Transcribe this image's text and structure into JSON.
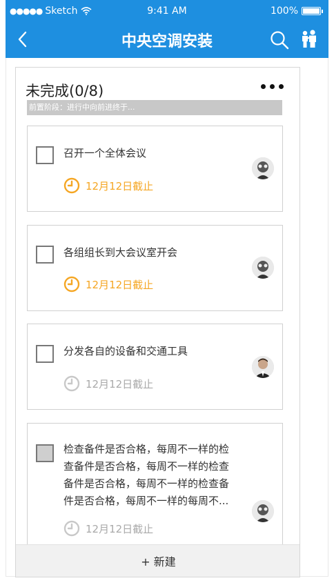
{
  "status_bar": {
    "carrier": "Sketch",
    "time": "9:41 AM",
    "battery": "100%"
  },
  "nav": {
    "title": "中央空调安装",
    "back_icon": "chevron-left-icon",
    "search_icon": "search-icon",
    "people_icon": "people-icon"
  },
  "panel": {
    "title": "未完成(0/8)",
    "stage": "前置阶段：进行中向前进终于...",
    "new_label": "+ 新建"
  },
  "tasks": [
    {
      "text": "召开一个全体会议",
      "due": "12月12日截止",
      "due_state": "orange",
      "checkbox_state": "unchecked"
    },
    {
      "text": "各组组长到大会议室开会",
      "due": "12月12日截止",
      "due_state": "orange",
      "checkbox_state": "unchecked"
    },
    {
      "text": "分发各自的设备和交通工具",
      "due": "12月12日截止",
      "due_state": "gray",
      "checkbox_state": "unchecked"
    },
    {
      "lines": [
        "检查备件是否合格，每周不一样的检",
        "查备件是否合格，每周不一样的检查",
        "备件是否合格，每周不一样的检查备",
        "件是否合格，每周不一样的每周不..."
      ],
      "due": "12月12日截止",
      "due_state": "gray",
      "checkbox_state": "disabled"
    }
  ],
  "colors": {
    "nav_bg": "#1e8fe0",
    "due_orange": "#f5a623",
    "due_gray": "#a9a9a9"
  }
}
